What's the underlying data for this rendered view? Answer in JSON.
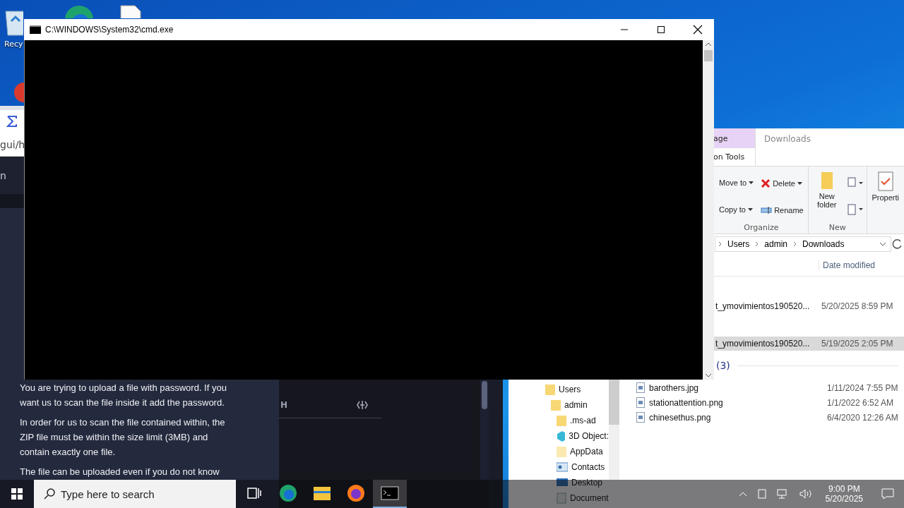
{
  "desktop_icons": [
    {
      "kind": "recycle_bin",
      "label": "Recy"
    },
    {
      "kind": "edge"
    },
    {
      "kind": "document"
    },
    {
      "kind": "app"
    }
  ],
  "browser": {
    "address": "gui/h",
    "header_text": "n",
    "dialog_paragraphs": [
      {
        "lines": [
          "You are trying to upload a file with password. If you",
          "want us to scan the file inside it add the password."
        ]
      },
      {
        "lines": [
          "In order for us to scan the file contained within, the",
          "ZIP file must be within the size limit (3MB) and",
          "contain exactly one file."
        ]
      },
      {
        "lines": [
          "The file can be uploaded even if you do not know"
        ]
      }
    ],
    "panel_letter": "H"
  },
  "cmd_window": {
    "title": "C:\\WINDOWS\\System32\\cmd.exe"
  },
  "explorer": {
    "context_tab": "age",
    "context_group": "on Tools",
    "title": "Downloads",
    "organize": {
      "label": "Organize",
      "move_to": "Move to",
      "copy_to": "Copy to",
      "delete": "Delete",
      "rename": "Rename"
    },
    "new_group": {
      "label": "New",
      "new_folder": "New folder"
    },
    "properties": "Properti",
    "breadcrumb": [
      "Users",
      "admin",
      "Downloads"
    ],
    "column_header": "Date modified",
    "recent_files": [
      {
        "name": "t_ymovimientos190520...",
        "date": "5/20/2025 8:59 PM",
        "selected": false
      },
      {
        "name": "t_ymovimientos190520...",
        "date": "5/19/2025 2:05 PM",
        "selected": true
      }
    ],
    "image_group": {
      "count": "(3)",
      "files": [
        {
          "name": "barothers.jpg",
          "date": "1/11/2024 7:55 PM",
          "selected": false
        },
        {
          "name": "stationattention.png",
          "date": "1/1/2022 6:52 AM",
          "selected": false
        },
        {
          "name": "chinesethus.png",
          "date": "6/4/2020 12:26 AM",
          "selected": false
        }
      ]
    },
    "nav_tree": [
      {
        "label": "Users",
        "kind": "folder",
        "children": [
          {
            "label": "admin",
            "kind": "folder",
            "children": [
              {
                "label": ".ms-ad",
                "kind": "folder"
              },
              {
                "label": "3D Object:",
                "kind": "objects"
              },
              {
                "label": "AppData",
                "kind": "folder_light"
              },
              {
                "label": "Contacts",
                "kind": "contacts"
              },
              {
                "label": "Desktop",
                "kind": "desktop"
              },
              {
                "label": "Document",
                "kind": "documents"
              }
            ]
          }
        ]
      }
    ]
  },
  "taskbar": {
    "search_placeholder": "Type here to search",
    "apps": [
      {
        "kind": "task_view",
        "selected": false
      },
      {
        "kind": "edge",
        "selected": false
      },
      {
        "kind": "explorer",
        "selected": false
      },
      {
        "kind": "firefox",
        "selected": false
      },
      {
        "kind": "cmd",
        "selected": true
      }
    ],
    "time": "9:00 PM",
    "date": "5/20/2025"
  }
}
